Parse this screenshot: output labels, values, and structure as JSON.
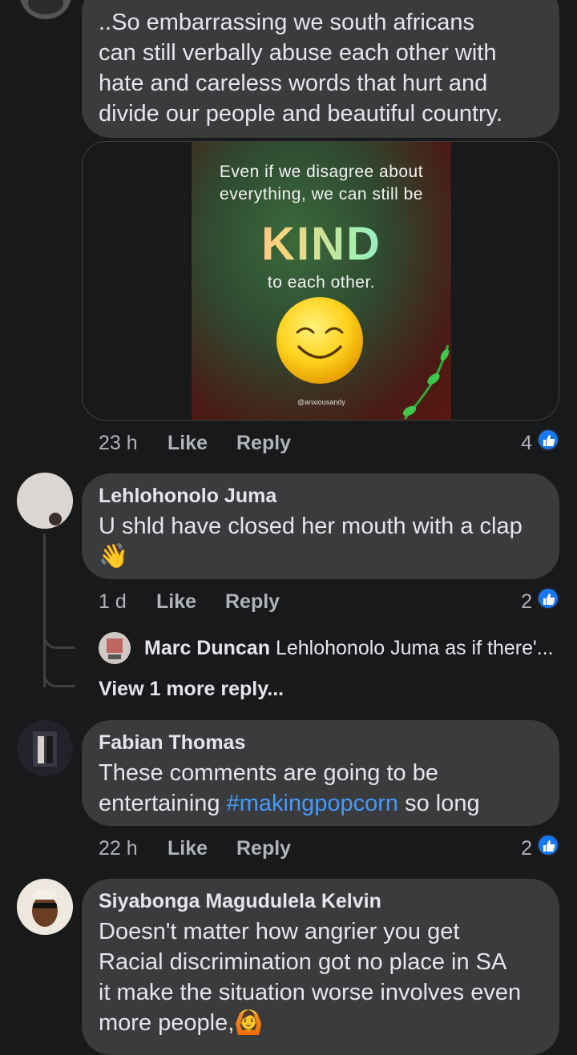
{
  "comments": [
    {
      "text_lines": [
        "..So embarrassing  we south africans",
        "can still verbally abuse each other with",
        "hate and careless words that hurt and",
        "divide our people and beautiful country."
      ],
      "image": {
        "line1": "Even if we disagree about",
        "line2": "everything, we can still be",
        "big_word": "KIND",
        "line3": "to each other.",
        "credit": "@anxiousandy"
      },
      "time": "23 h",
      "like_label": "Like",
      "reply_label": "Reply",
      "reactions": "4"
    },
    {
      "author": "Lehlohonolo Juma",
      "text": "U shld have closed her mouth with a clap",
      "emoji": "👋",
      "time": "1 d",
      "like_label": "Like",
      "reply_label": "Reply",
      "reactions": "2",
      "reply_preview": {
        "author": "Marc Duncan",
        "text": "Lehlohonolo Juma as if there'..."
      },
      "view_more": "View 1 more reply..."
    },
    {
      "author": "Fabian Thomas",
      "line1": "These comments are going to be",
      "line2_prefix": "entertaining ",
      "hashtag": "#makingpopcorn",
      "line2_suffix": " so long",
      "time": "22 h",
      "like_label": "Like",
      "reply_label": "Reply",
      "reactions": "2"
    },
    {
      "author": "Siyabonga Magudulela Kelvin",
      "text_lines": [
        "Doesn't matter how angrier you get",
        "Racial discrimination got no place in SA",
        "it make the situation worse involves even"
      ],
      "last_line": "more people,",
      "emoji": "🙆"
    }
  ],
  "colors": {
    "background": "#18191a",
    "bubble": "#3a3b3c",
    "text": "#e4e6eb",
    "meta": "#b0b3b8",
    "link": "#4599ff",
    "like": "#1877f2"
  },
  "icons": {
    "reaction": "thumbs-up-icon"
  }
}
